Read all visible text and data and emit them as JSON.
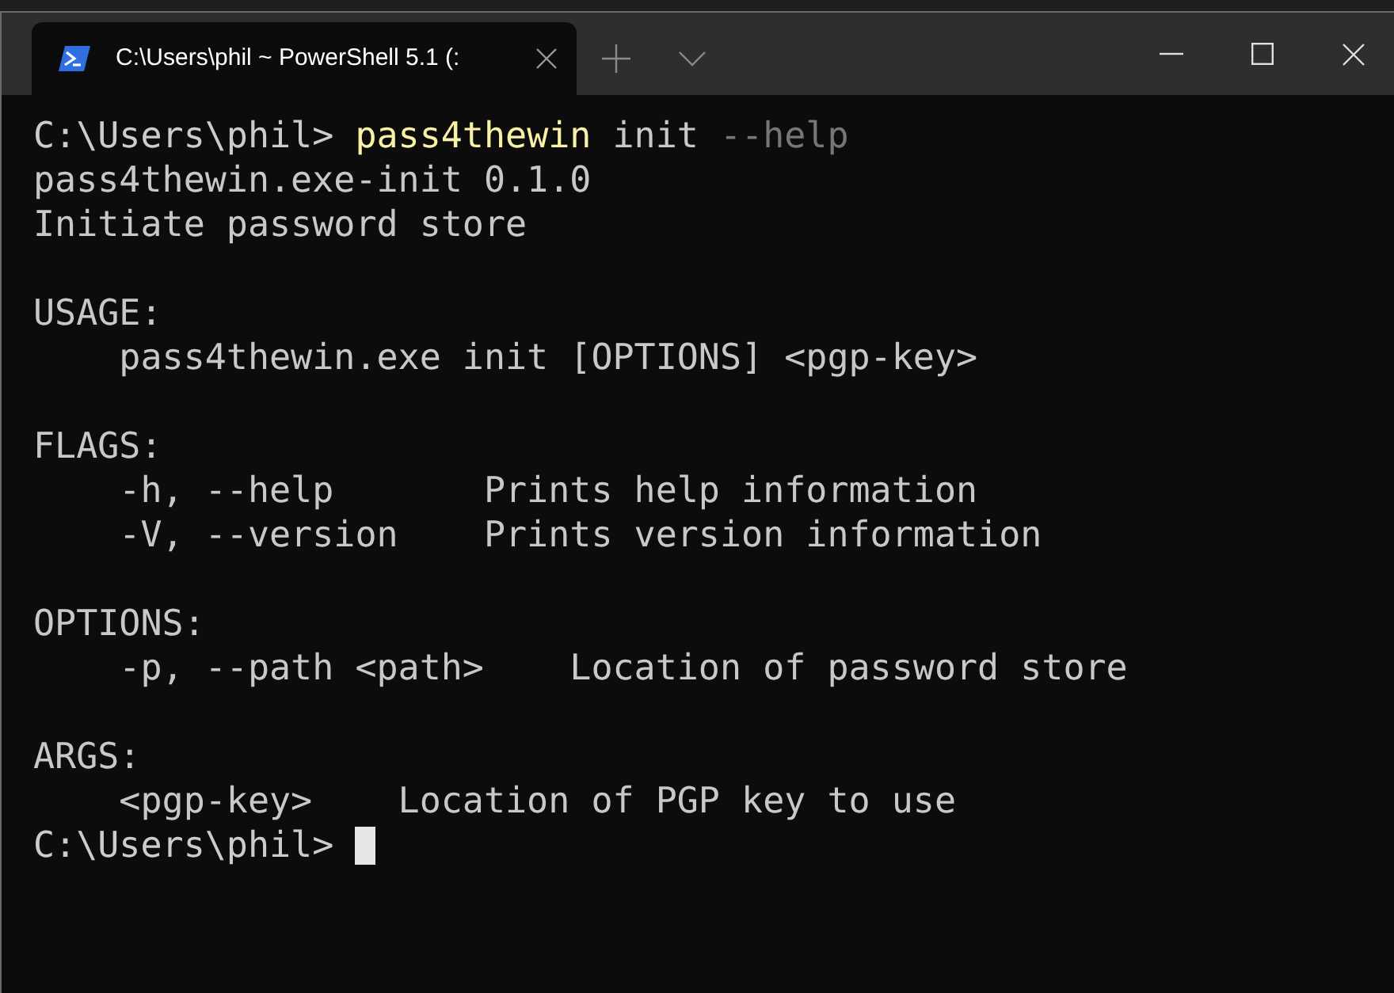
{
  "tab": {
    "title": "C:\\Users\\phil ~ PowerShell 5.1 (:",
    "selected": true
  },
  "terminal": {
    "blocks": [
      {
        "lines": [
          {
            "segments": [
              {
                "kind": "prompt",
                "text": "C:\\Users\\phil> "
              },
              {
                "kind": "command",
                "text": "pass4thewin"
              },
              {
                "kind": "output",
                "text": " init "
              },
              {
                "kind": "param",
                "text": "--help"
              }
            ]
          },
          {
            "segments": [
              {
                "kind": "output",
                "text": "pass4thewin.exe-init 0.1.0"
              }
            ]
          },
          {
            "segments": [
              {
                "kind": "output",
                "text": "Initiate password store"
              }
            ]
          }
        ]
      },
      {
        "lines": [
          {
            "segments": [
              {
                "kind": "output",
                "text": "USAGE:"
              }
            ]
          },
          {
            "segments": [
              {
                "kind": "output",
                "text": "    pass4thewin.exe init [OPTIONS] <pgp-key>"
              }
            ]
          }
        ]
      },
      {
        "lines": [
          {
            "segments": [
              {
                "kind": "output",
                "text": "FLAGS:"
              }
            ]
          },
          {
            "segments": [
              {
                "kind": "output",
                "text": "    -h, --help       Prints help information"
              }
            ]
          },
          {
            "segments": [
              {
                "kind": "output",
                "text": "    -V, --version    Prints version information"
              }
            ]
          }
        ]
      },
      {
        "lines": [
          {
            "segments": [
              {
                "kind": "output",
                "text": "OPTIONS:"
              }
            ]
          },
          {
            "segments": [
              {
                "kind": "output",
                "text": "    -p, --path <path>    Location of password store"
              }
            ]
          }
        ]
      },
      {
        "lines": [
          {
            "segments": [
              {
                "kind": "output",
                "text": "ARGS:"
              }
            ]
          },
          {
            "segments": [
              {
                "kind": "output",
                "text": "    <pgp-key>    Location of PGP key to use"
              }
            ]
          },
          {
            "cursor": true,
            "segments": [
              {
                "kind": "prompt",
                "text": "C:\\Users\\phil> "
              }
            ]
          }
        ]
      }
    ]
  }
}
